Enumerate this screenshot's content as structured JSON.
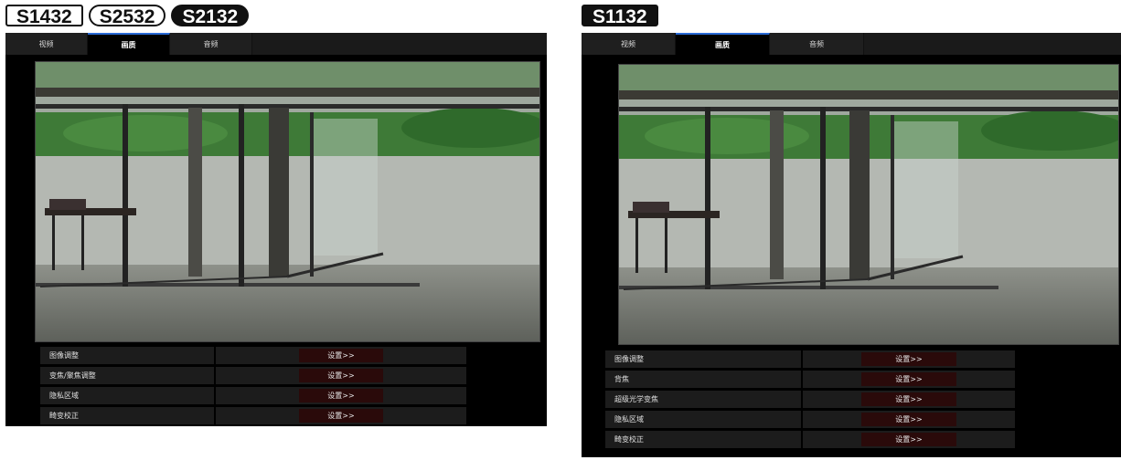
{
  "left": {
    "badges": [
      "S1432",
      "S2532",
      "S2132"
    ],
    "tabs": [
      "视频",
      "画质",
      "音频"
    ],
    "active_tab": 1,
    "settings": [
      {
        "label": "图像调整",
        "button": "设置>>"
      },
      {
        "label": "变焦/聚焦调整",
        "button": "设置>>"
      },
      {
        "label": "隐私区域",
        "button": "设置>>"
      },
      {
        "label": "畸变校正",
        "button": "设置>>"
      }
    ]
  },
  "right": {
    "badges": [
      "S1132"
    ],
    "tabs": [
      "视频",
      "画质",
      "音频"
    ],
    "active_tab": 1,
    "settings": [
      {
        "label": "图像调整",
        "button": "设置>>"
      },
      {
        "label": "背焦",
        "button": "设置>>"
      },
      {
        "label": "超级光学变焦",
        "button": "设置>>"
      },
      {
        "label": "隐私区域",
        "button": "设置>>"
      },
      {
        "label": "畸变校正",
        "button": "设置>>"
      }
    ]
  },
  "colors": {
    "frame_bg": "#000000",
    "active_tab_accent": "#2a6ad6",
    "button_bg": "#2a0a0a"
  }
}
